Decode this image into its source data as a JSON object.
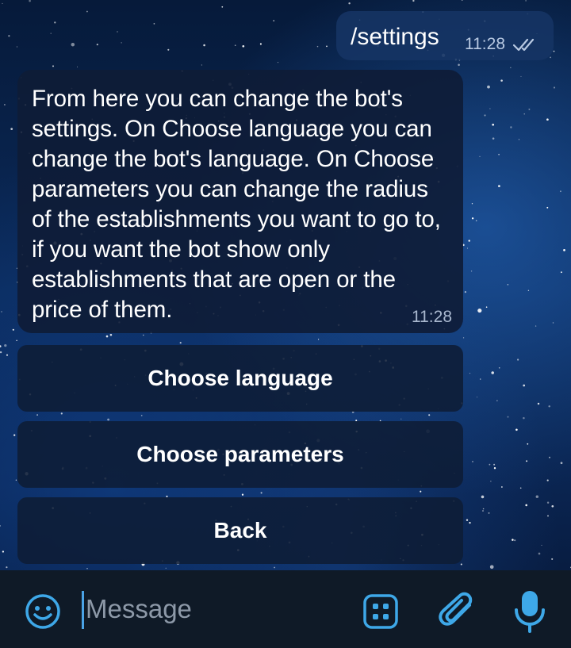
{
  "colors": {
    "accent": "#3ea8e8",
    "outgoing_bubble": "#163464",
    "incoming_bubble": "#0e1c36",
    "input_bar": "#0f1a27"
  },
  "chat": {
    "outgoing": {
      "text": "/settings",
      "time": "11:28",
      "status_icon": "double-check-icon"
    },
    "incoming": {
      "text": "From here you can change the bot's settings. On Choose language you can change the bot's language. On Choose parameters you can change the radius of the establishments you want to go to, if you want the bot show only establishments that are open or the price of them.",
      "time": "11:28"
    }
  },
  "keyboard": {
    "buttons": [
      "Choose language",
      "Choose parameters",
      "Back"
    ]
  },
  "composer": {
    "placeholder": "Message",
    "icons": [
      "emoji-icon",
      "bot-menu-icon",
      "attach-icon",
      "microphone-icon"
    ]
  }
}
